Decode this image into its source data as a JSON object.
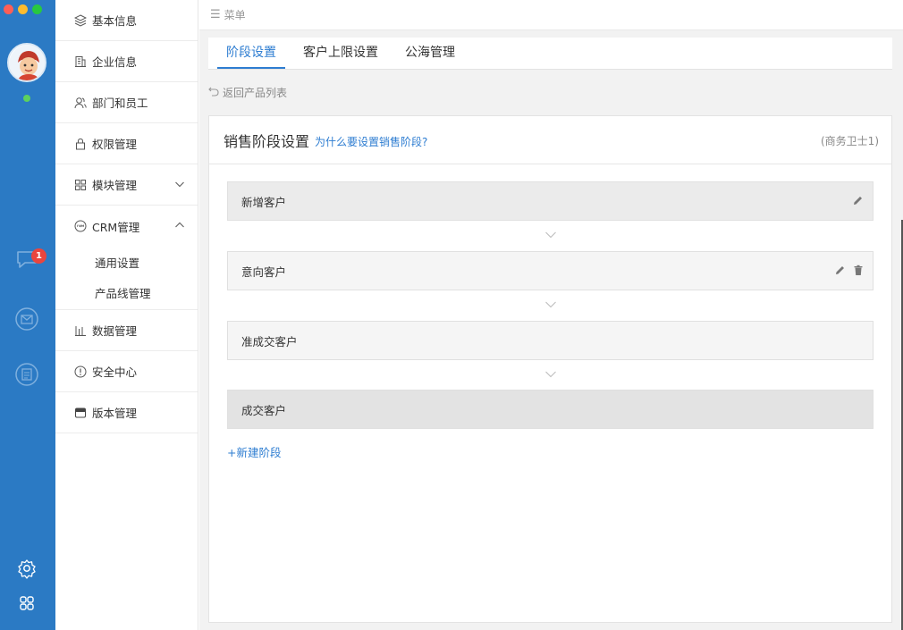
{
  "colors": {
    "rail": "#2b7ac4",
    "accent": "#2e7dd1",
    "badge": "#e9453e",
    "online": "#5dd15d"
  },
  "rail": {
    "icons": [
      "chat-icon",
      "mail-icon",
      "document-icon",
      "settings-icon",
      "apps-grid-icon"
    ],
    "chat_badge": "1"
  },
  "menu": {
    "items": [
      {
        "label": "基本信息",
        "icon": "layers-icon"
      },
      {
        "label": "企业信息",
        "icon": "building-icon"
      },
      {
        "label": "部门和员工",
        "icon": "users-icon"
      },
      {
        "label": "权限管理",
        "icon": "lock-icon"
      },
      {
        "label": "模块管理",
        "icon": "modules-icon"
      },
      {
        "label": "CRM管理",
        "icon": "crm-icon"
      },
      {
        "label": "数据管理",
        "icon": "bar-chart-icon"
      },
      {
        "label": "安全中心",
        "icon": "alert-circle-icon"
      },
      {
        "label": "版本管理",
        "icon": "version-icon"
      }
    ],
    "crm_sub": [
      "通用设置",
      "产品线管理"
    ]
  },
  "topbar": {
    "label": "菜单"
  },
  "tabs": [
    "阶段设置",
    "客户上限设置",
    "公海管理"
  ],
  "back_label": "返回产品列表",
  "panel": {
    "title": "销售阶段设置",
    "help_link": "为什么要设置销售阶段?",
    "tag": "(商务卫士1)",
    "stages": [
      "新增客户",
      "意向客户",
      "准成交客户",
      "成交客户"
    ],
    "new_stage": "+新建阶段"
  }
}
